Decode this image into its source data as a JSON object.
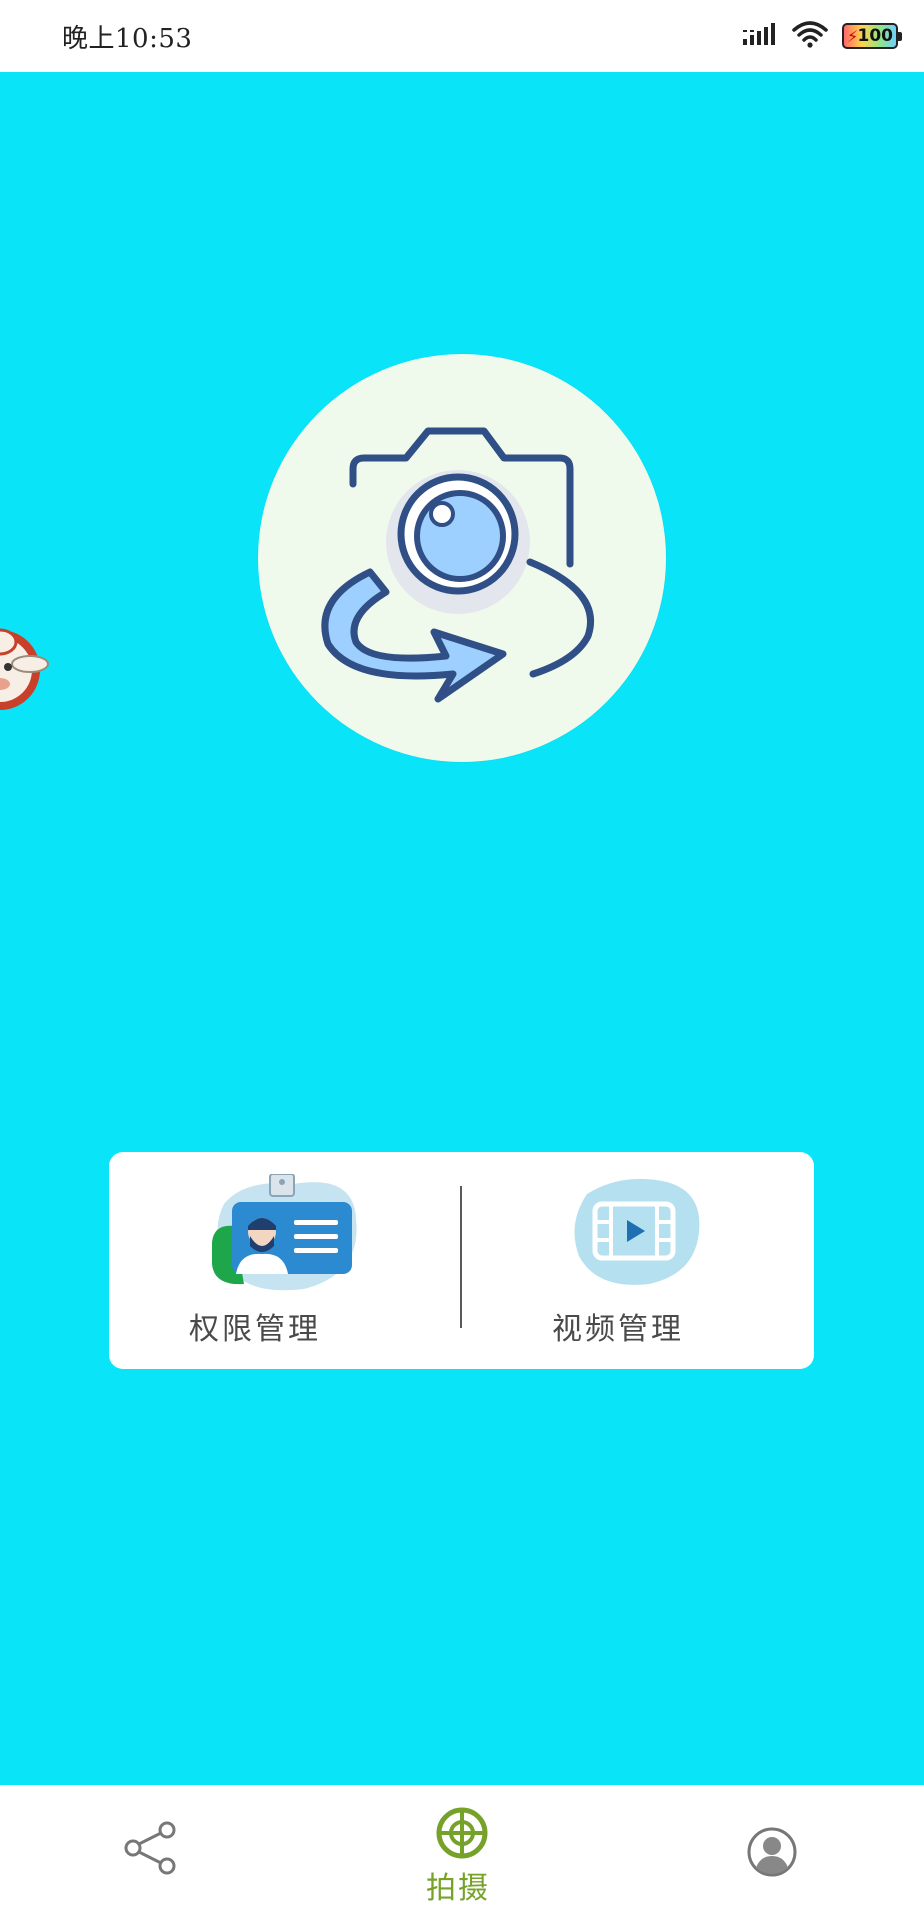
{
  "status_bar": {
    "time": "晚上10:53",
    "battery_level": "100",
    "icons": [
      "signal-icon",
      "wifi-icon",
      "battery-icon"
    ]
  },
  "main": {
    "background_color": "#0ae4f9",
    "hero_icon": "camera-rotate-icon"
  },
  "card": {
    "items": [
      {
        "label": "权限管理",
        "icon": "id-badge-icon"
      },
      {
        "label": "视频管理",
        "icon": "video-film-icon"
      }
    ]
  },
  "bottom_nav": {
    "active_color": "#76a22a",
    "items": [
      {
        "label": "",
        "icon": "share-icon"
      },
      {
        "label": "拍摄",
        "icon": "crosshair-icon",
        "active": true
      },
      {
        "label": "",
        "icon": "user-icon"
      }
    ]
  }
}
